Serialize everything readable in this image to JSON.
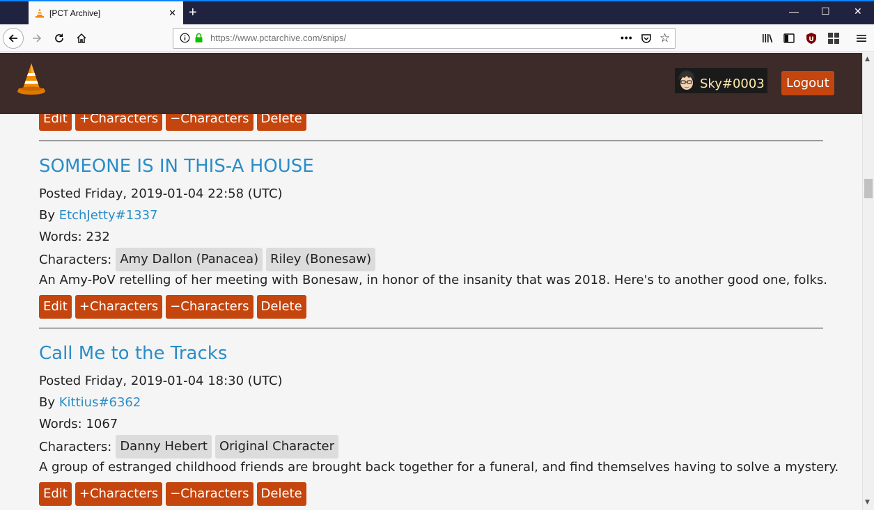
{
  "browser": {
    "tab_title": "[PCT Archive]",
    "tab_close": "✕",
    "new_tab": "+",
    "window_min": "—",
    "window_max": "☐",
    "window_close": "✕",
    "url_host": "https://www.pctarchive.com",
    "url_path": "/snips/",
    "page_actions": "•••",
    "bookmark_star": "☆"
  },
  "header": {
    "username": "Sky#0003",
    "logout_label": "Logout"
  },
  "buttons": {
    "edit": "Edit",
    "add_characters": "+Characters",
    "remove_characters": "−Characters",
    "delete": "Delete"
  },
  "snips": [
    {
      "title": "SOMEONE IS IN THIS-A HOUSE",
      "posted": "Posted Friday, 2019-01-04 22:58 (UTC)",
      "by_prefix": "By ",
      "author": "EtchJetty#1337",
      "words": "Words: 232",
      "characters_label": "Characters:",
      "characters": [
        "Amy Dallon (Panacea)",
        "Riley (Bonesaw)"
      ],
      "summary": "An Amy-PoV retelling of her meeting with Bonesaw, in honor of the insanity that was 2018. Here's to another good one, folks."
    },
    {
      "title": "Call Me to the Tracks",
      "posted": "Posted Friday, 2019-01-04 18:30 (UTC)",
      "by_prefix": "By ",
      "author": "Kittius#6362",
      "words": "Words: 1067",
      "characters_label": "Characters:",
      "characters": [
        "Danny Hebert",
        "Original Character"
      ],
      "summary": "A group of estranged childhood friends are brought back together for a funeral, and find themselves having to solve a mystery."
    }
  ],
  "colors": {
    "header_bg": "#3c2b28",
    "button": "#c4450d",
    "link": "#2a8dc7",
    "tag_bg": "#dcdcdc"
  }
}
